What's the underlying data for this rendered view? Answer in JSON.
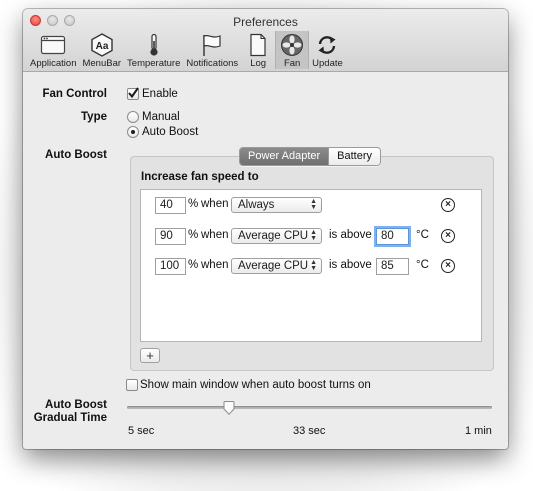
{
  "window": {
    "title": "Preferences"
  },
  "toolbar": {
    "items": [
      {
        "label": "Application",
        "icon": "application-window-icon"
      },
      {
        "label": "MenuBar",
        "icon": "menubar-aa-icon"
      },
      {
        "label": "Temperature",
        "icon": "thermometer-icon"
      },
      {
        "label": "Notifications",
        "icon": "flag-icon"
      },
      {
        "label": "Log",
        "icon": "document-icon"
      },
      {
        "label": "Fan",
        "icon": "fan-icon",
        "selected": true
      },
      {
        "label": "Update",
        "icon": "refresh-icon"
      }
    ]
  },
  "fan_control": {
    "label": "Fan Control",
    "checkbox_label": "Enable",
    "checked": true
  },
  "type": {
    "label": "Type",
    "options": [
      {
        "label": "Manual",
        "selected": false
      },
      {
        "label": "Auto Boost",
        "selected": true
      }
    ]
  },
  "auto_boost": {
    "label": "Auto Boost",
    "tabs": [
      {
        "label": "Power Adapter",
        "selected": true
      },
      {
        "label": "Battery",
        "selected": false
      }
    ],
    "header": "Increase fan speed to",
    "rules": [
      {
        "percent": "40",
        "pct_sign": "%",
        "when": "when",
        "condition": "Always"
      },
      {
        "percent": "90",
        "pct_sign": "%",
        "when": "when",
        "condition": "Average CPU",
        "is_above": "is above",
        "threshold": "80",
        "unit": "°C"
      },
      {
        "percent": "100",
        "pct_sign": "%",
        "when": "when",
        "condition": "Average CPU",
        "is_above": "is above",
        "threshold": "85",
        "unit": "°C"
      }
    ],
    "add_label": "+",
    "remove_label": "×"
  },
  "show_main_window": {
    "label": "Show main window when auto boost turns on",
    "checked": false
  },
  "gradual_time": {
    "label_line1": "Auto Boost",
    "label_line2": "Gradual Time",
    "ticks": [
      "5 sec",
      "33 sec",
      "1 min"
    ],
    "value_fraction": 0.28
  },
  "colors": {
    "accent": "#3478f6",
    "selected_tab": "#7c7c7c",
    "close": "#e0443e"
  }
}
